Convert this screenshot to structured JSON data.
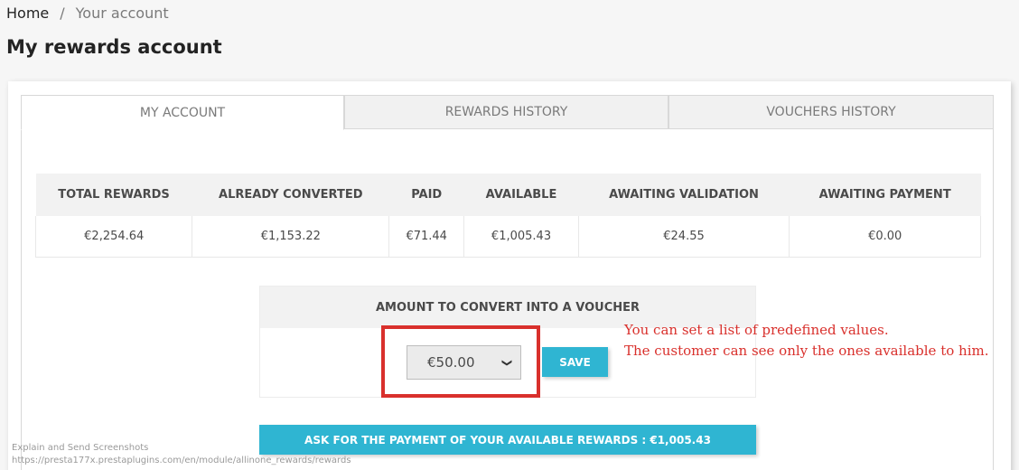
{
  "breadcrumb": {
    "home": "Home",
    "separator": "/",
    "current": "Your account"
  },
  "page": {
    "title": "My rewards account"
  },
  "tabs": [
    {
      "label": "MY ACCOUNT",
      "active": true
    },
    {
      "label": "REWARDS HISTORY",
      "active": false
    },
    {
      "label": "VOUCHERS HISTORY",
      "active": false
    }
  ],
  "summary": {
    "headers": [
      "TOTAL REWARDS",
      "ALREADY CONVERTED",
      "PAID",
      "AVAILABLE",
      "AWAITING VALIDATION",
      "AWAITING PAYMENT"
    ],
    "values": [
      "€2,254.64",
      "€1,153.22",
      "€71.44",
      "€1,005.43",
      "€24.55",
      "€0.00"
    ]
  },
  "convert": {
    "heading": "AMOUNT TO CONVERT INTO A VOUCHER",
    "selected_value": "€50.00",
    "save_label": "SAVE"
  },
  "annotation": {
    "line1": "You can set a list of predefined values.",
    "line2": "The customer can see only the ones available to him."
  },
  "payment": {
    "button_label": "ASK FOR THE PAYMENT OF YOUR AVAILABLE REWARDS : €1,005.43"
  },
  "watermark": {
    "line1": "Explain and Send Screenshots",
    "line2": "https://presta177x.prestaplugins.com/en/module/allinone_rewards/rewards"
  },
  "colors": {
    "accent": "#2fb5d2",
    "annotation": "#d9302c"
  }
}
